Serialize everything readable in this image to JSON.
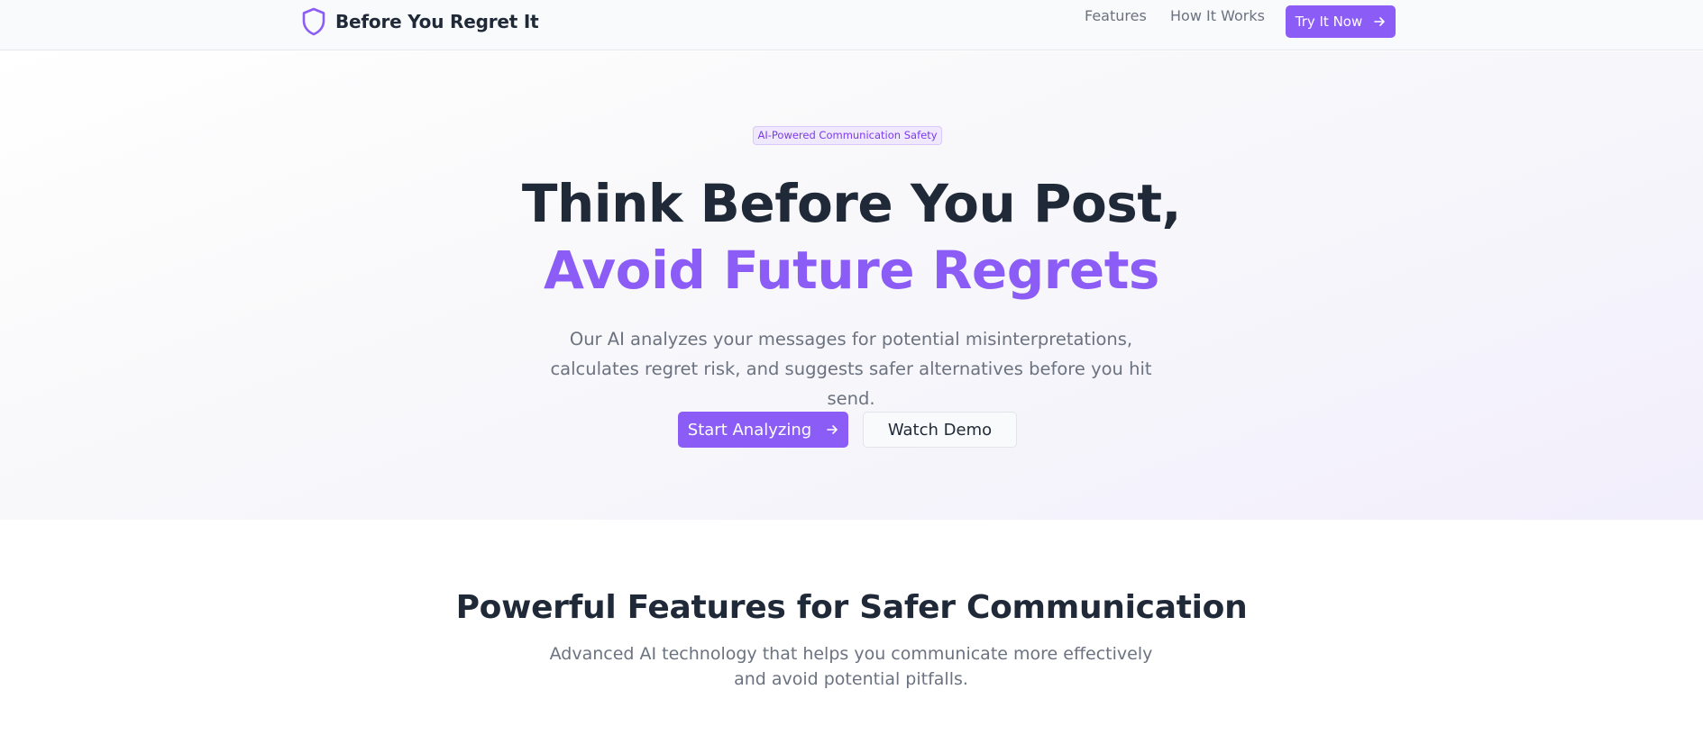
{
  "header": {
    "brand_name": "Before You Regret It",
    "brand_icon": "shield-icon",
    "nav": {
      "features_label": "Features",
      "how_it_works_label": "How It Works"
    },
    "cta_label": "Try It Now",
    "cta_icon": "arrow-right-icon"
  },
  "hero": {
    "badge": "AI-Powered Communication Safety",
    "headline_line1": "Think Before You Post,",
    "headline_line2": "Avoid Future Regrets",
    "subtitle": "Our AI analyzes your messages for potential misinterpretations, calculates regret risk, and suggests safer alternatives before you hit send.",
    "primary_button": "Start Analyzing",
    "secondary_button": "Watch Demo"
  },
  "features": {
    "title": "Powerful Features for Safer Communication",
    "subtitle": "Advanced AI technology that helps you communicate more effectively and avoid potential pitfalls."
  },
  "colors": {
    "accent": "#8b5cf6",
    "heading": "#1f2937",
    "muted": "#6b7280"
  }
}
